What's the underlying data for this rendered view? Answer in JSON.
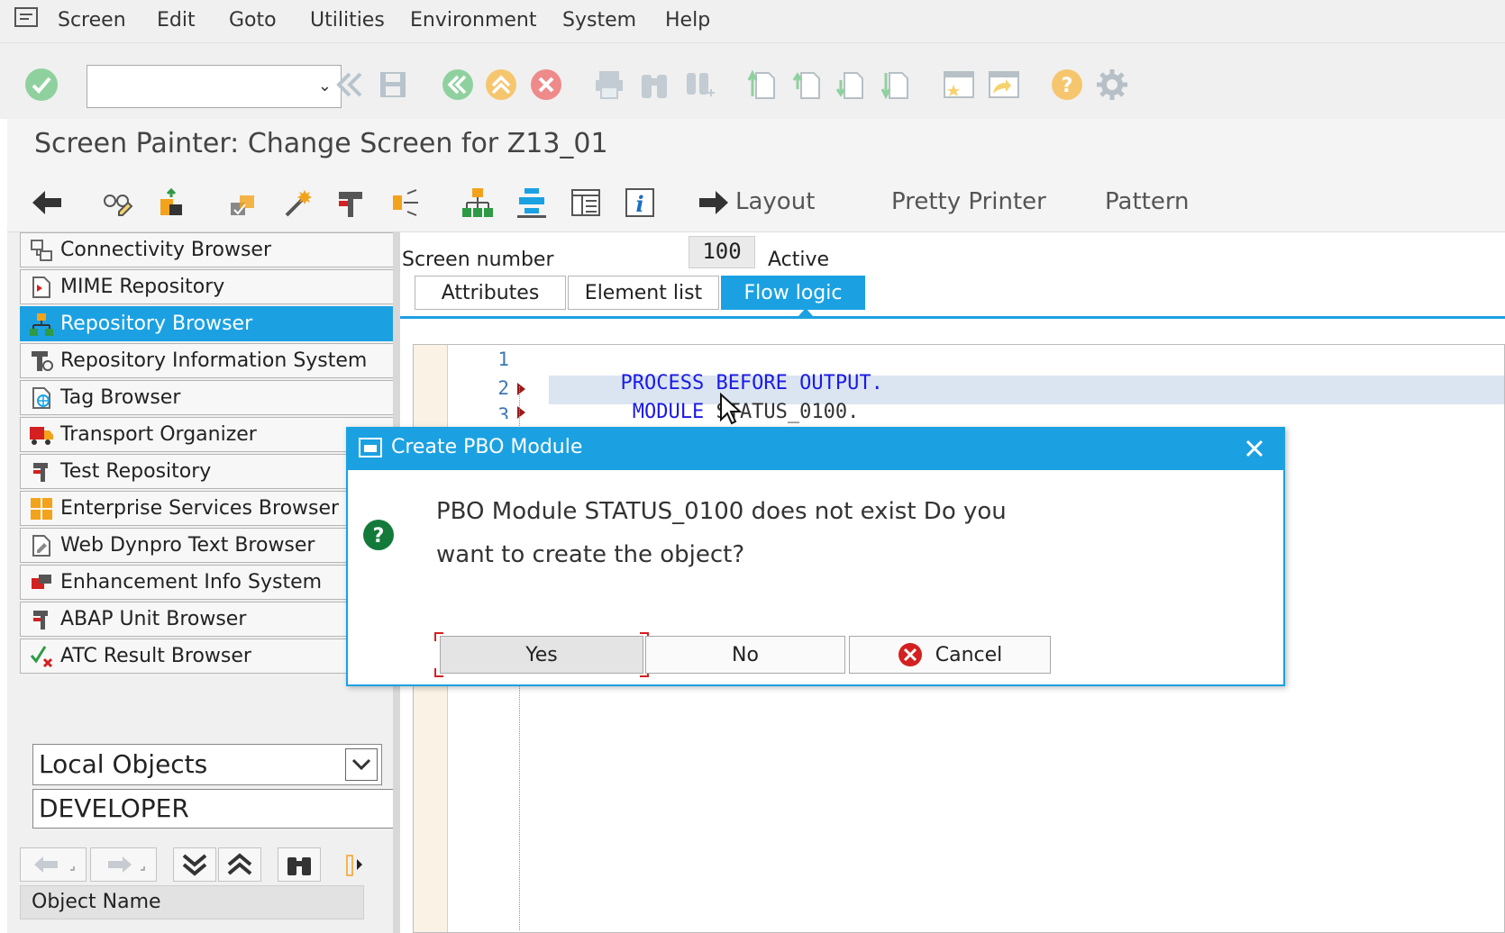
{
  "menu": {
    "items": [
      "Screen",
      "Edit",
      "Goto",
      "Utilities",
      "Environment",
      "System",
      "Help"
    ]
  },
  "standard_toolbar": {
    "command_field_value": "",
    "icons": [
      "enter-icon",
      "back-double-icon",
      "save-icon",
      "back-icon",
      "exit-icon",
      "cancel-icon",
      "print-icon",
      "find-icon",
      "find-next-icon",
      "first-page-icon",
      "previous-page-icon",
      "next-page-icon",
      "last-page-icon",
      "create-session-icon",
      "shortcut-icon",
      "help-icon",
      "customize-icon"
    ]
  },
  "title": "Screen Painter: Change Screen for Z13_01",
  "app_toolbar": {
    "icons": [
      "back-arrow-icon",
      "display-change-icon",
      "activate-icon",
      "check-icon",
      "wizard-icon",
      "where-used-icon",
      "navigation-icon",
      "hierarchy-icon",
      "object-list-icon",
      "display-object-list-icon",
      "info-icon"
    ],
    "layout_label": "Layout",
    "pretty_printer_label": "Pretty Printer",
    "pattern_label": "Pattern"
  },
  "navigation": {
    "items": [
      {
        "label": "Connectivity Browser",
        "icon": "connectivity-icon"
      },
      {
        "label": "MIME Repository",
        "icon": "mime-icon"
      },
      {
        "label": "Repository Browser",
        "icon": "repository-tree-icon",
        "active": true
      },
      {
        "label": "Repository Information System",
        "icon": "info-system-icon"
      },
      {
        "label": "Tag Browser",
        "icon": "tag-icon"
      },
      {
        "label": "Transport Organizer",
        "icon": "truck-icon"
      },
      {
        "label": "Test Repository",
        "icon": "test-icon"
      },
      {
        "label": "Enterprise Services Browser",
        "icon": "services-icon"
      },
      {
        "label": "Web Dynpro Text Browser",
        "icon": "text-browser-icon"
      },
      {
        "label": "Enhancement Info System",
        "icon": "enhancement-icon"
      },
      {
        "label": "ABAP Unit Browser",
        "icon": "unit-icon"
      },
      {
        "label": "ATC Result Browser",
        "icon": "atc-icon"
      }
    ],
    "object_type": "Local Objects",
    "object_value": "DEVELOPER",
    "column_header": "Object Name"
  },
  "screen": {
    "number_label": "Screen number",
    "number": "100",
    "status": "Active",
    "tabs": [
      "Attributes",
      "Element list",
      "Flow logic"
    ],
    "selected_tab": "Flow logic"
  },
  "code": {
    "line_numbers": [
      "1",
      "2",
      "3"
    ],
    "lines": [
      {
        "keyword": "PROCESS BEFORE OUTPUT.",
        "rest": ""
      },
      {
        "keyword": " MODULE",
        "rest": " STATUS_0100."
      }
    ]
  },
  "dialog": {
    "title": "Create PBO Module",
    "message_line1": "PBO Module STATUS_0100 does not exist Do you",
    "message_line2": "want to create the object?",
    "yes": "Yes",
    "no": "No",
    "cancel": "Cancel"
  },
  "colors": {
    "accent": "#1ba1e2",
    "keyword": "#1a1ae6",
    "menu_bg": "#f0f0f0"
  }
}
